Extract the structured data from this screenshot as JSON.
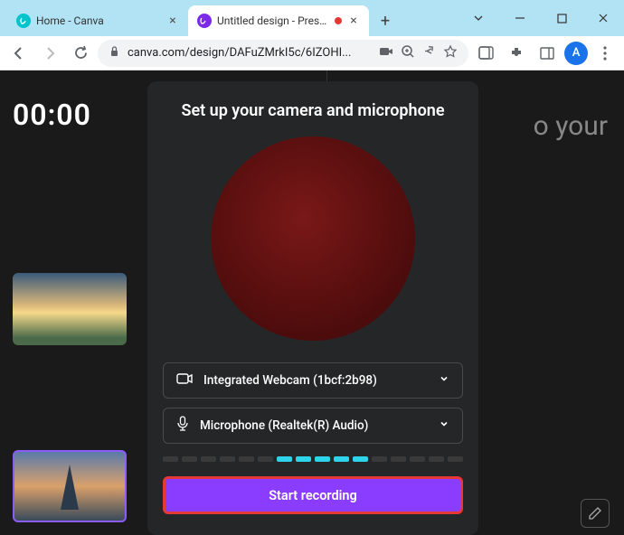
{
  "window": {
    "tabs": [
      {
        "title": "Home - Canva",
        "active": false
      },
      {
        "title": "Untitled design - Presen",
        "active": true,
        "recording": true
      }
    ]
  },
  "toolbar": {
    "url": "canva.com/design/DAFuZMrkI5c/6IZOHI...",
    "avatar_letter": "A"
  },
  "content": {
    "timer": "00:00",
    "bg_text_fragment": "o your"
  },
  "modal": {
    "title": "Set up your camera and microphone",
    "camera_select": "Integrated Webcam (1bcf:2b98)",
    "mic_select": "Microphone (Realtek(R) Audio)",
    "meter_segments": [
      false,
      false,
      false,
      false,
      false,
      false,
      true,
      true,
      true,
      true,
      true,
      false,
      false,
      false,
      false,
      false
    ],
    "start_button": "Start recording"
  }
}
